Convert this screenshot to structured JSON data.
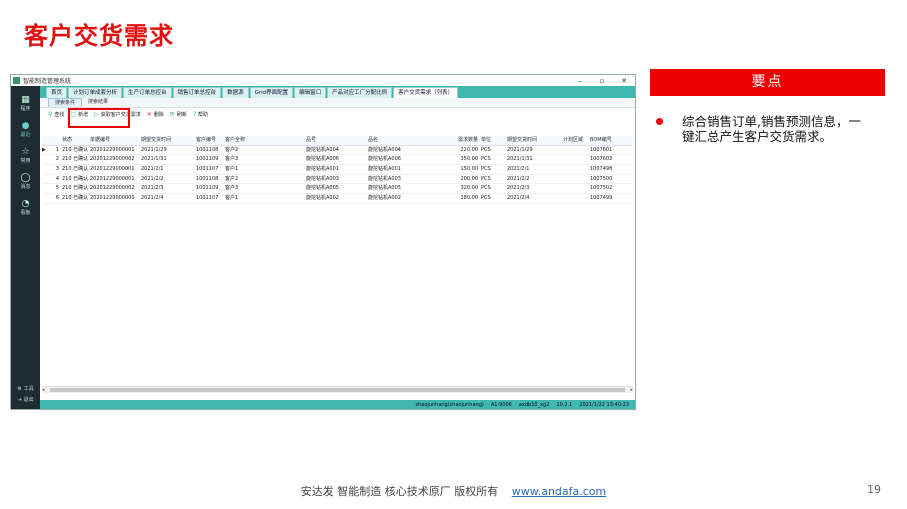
{
  "slide": {
    "title": "客户交货需求",
    "page_number": "19"
  },
  "window": {
    "title": "智能制造管理系统",
    "controls": [
      "–",
      "▫",
      "✕"
    ]
  },
  "nav": {
    "items": [
      {
        "icon": "grid-icon",
        "label": "程序"
      },
      {
        "icon": "clock-icon",
        "label": "最近",
        "active": true
      },
      {
        "icon": "star-icon",
        "label": "常用"
      },
      {
        "icon": "chat-icon",
        "label": "消息"
      },
      {
        "icon": "pie-chart-icon",
        "label": "看板"
      }
    ],
    "bottom": [
      {
        "icon": "gear-icon",
        "label": "工具"
      },
      {
        "icon": "exit-icon",
        "label": "退出"
      }
    ]
  },
  "tabs": [
    "首页",
    "计划订单成套分析",
    "生产订单总控台",
    "销售订单总控台",
    "数据源",
    "Grid界面配置",
    "编辑窗口",
    "产品对应工厂分配比例",
    "客户交货需求（列表）"
  ],
  "subtabs": [
    "搜索条件",
    "搜索结果"
  ],
  "toolbar": {
    "search": "查找",
    "new": "新增",
    "fetch": "获取客户交货需求",
    "delete": "删除",
    "refresh": "刷新",
    "help": "帮助"
  },
  "grid": {
    "columns": [
      "",
      "",
      "状态",
      "单据编号",
      "期望交货时间",
      "客户编号",
      "客户全称",
      "品号",
      "品名",
      "需求数量",
      "单位",
      "期望交货时间",
      "计划区域",
      "BOM编号"
    ],
    "rows": [
      [
        "▶",
        "1",
        "210 已确认",
        "20201229000001",
        "2021/1/29",
        "1001108",
        "客户2",
        "旋挖钻机A004",
        "旋挖钻机A004",
        "220.00",
        "PCS",
        "2021/1/29",
        "",
        "1007601"
      ],
      [
        "",
        "2",
        "210 已确认",
        "20201229000002",
        "2021/1/31",
        "1001109",
        "客户3",
        "旋挖钻机A006",
        "旋挖钻机A006",
        "350.00",
        "PCS",
        "2021/1/31",
        "",
        "1007603"
      ],
      [
        "",
        "3",
        "210 已确认",
        "20201229000001",
        "2021/2/1",
        "1001107",
        "客户1",
        "旋挖钻机A001",
        "旋挖钻机A001",
        "150.00",
        "PCS",
        "2021/2/1",
        "",
        "1007498"
      ],
      [
        "",
        "4",
        "210 已确认",
        "20201229000001",
        "2021/2/2",
        "1001108",
        "客户2",
        "旋挖钻机A003",
        "旋挖钻机A003",
        "200.00",
        "PCS",
        "2021/2/2",
        "",
        "1007500"
      ],
      [
        "",
        "5",
        "210 已确认",
        "20201229000002",
        "2021/2/3",
        "1001109",
        "客户3",
        "旋挖钻机A005",
        "旋挖钻机A005",
        "320.00",
        "PCS",
        "2021/2/3",
        "",
        "1007502"
      ],
      [
        "",
        "6",
        "210 已确认",
        "20201229000000",
        "2021/2/4",
        "1001107",
        "客户1",
        "旋挖钻机A002",
        "旋挖钻机A002",
        "180.00",
        "PCS",
        "2021/2/4",
        "",
        "1007499"
      ]
    ]
  },
  "statusbar": {
    "user": "shaojunhang(shaojunhang)",
    "cell": "A1:9006",
    "db": "axdb10_xg2",
    "version": "10.2.1",
    "datetime": "2021/1/22 13:40:23"
  },
  "keypoints": {
    "banner": "要点",
    "text": "综合销售订单,销售预测信息，一键汇总产生客户交货需求。"
  },
  "footer": {
    "company": "安达发   智能制造 核心技术原厂   版权所有",
    "link": "www.andafa.com"
  },
  "colors": {
    "accent_red": "#e00000",
    "app_teal": "#3fb9b0",
    "nav_dark": "#1e2b30"
  }
}
